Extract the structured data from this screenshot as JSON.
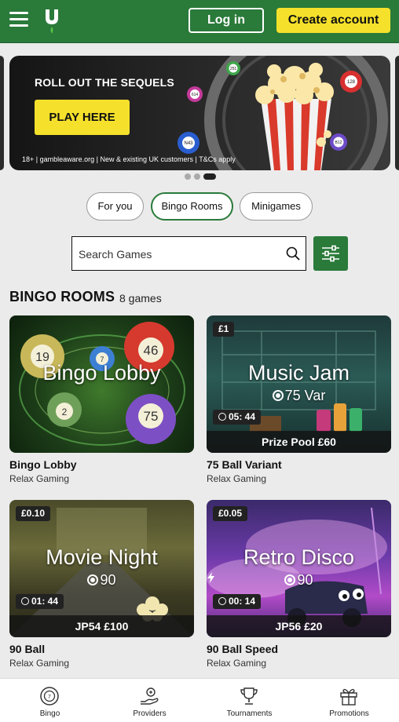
{
  "header": {
    "login_label": "Log in",
    "create_account_label": "Create account",
    "brand_color": "#2a7a3a",
    "accent_color": "#f5e12b"
  },
  "banner": {
    "title": "ROLL OUT THE SEQUELS",
    "cta_label": "PLAY HERE",
    "disclaimer": "18+ | gambleaware.org | New & existing UK customers | T&Cs apply",
    "balls": [
      "251",
      "614",
      "128",
      "N43",
      "B12"
    ],
    "active_slide": 3,
    "slide_count": 3
  },
  "tabs": [
    {
      "label": "For you",
      "active": false
    },
    {
      "label": "Bingo Rooms",
      "active": true
    },
    {
      "label": "Minigames",
      "active": false
    }
  ],
  "search": {
    "placeholder": "Search Games"
  },
  "section": {
    "title": "BINGO ROOMS",
    "count": "8 games"
  },
  "cards": [
    {
      "thumb_title": "Bingo Lobby",
      "thumb_sub": "",
      "price": "",
      "timer": "",
      "prize": "",
      "name": "Bingo Lobby",
      "provider": "Relax Gaming",
      "balls": [
        "19",
        "46",
        "7",
        "2",
        "75"
      ]
    },
    {
      "thumb_title": "Music Jam",
      "thumb_sub": "75 Var",
      "price": "£1",
      "timer": "05: 44",
      "prize": "Prize Pool £60",
      "name": "75 Ball Variant",
      "provider": "Relax Gaming"
    },
    {
      "thumb_title": "Movie Night",
      "thumb_sub": "90",
      "price": "£0.10",
      "timer": "01: 44",
      "prize": "JP54 £100",
      "name": "90 Ball",
      "provider": "Relax Gaming"
    },
    {
      "thumb_title": "Retro Disco",
      "thumb_sub": "90",
      "price": "£0.05",
      "timer": "00: 14",
      "prize": "JP56 £20",
      "name": "90 Ball Speed",
      "provider": "Relax Gaming"
    }
  ],
  "bottom_nav": [
    {
      "label": "Bingo",
      "icon": "bingo-ball-icon"
    },
    {
      "label": "Providers",
      "icon": "providers-icon"
    },
    {
      "label": "Tournaments",
      "icon": "trophy-icon"
    },
    {
      "label": "Promotions",
      "icon": "gift-icon"
    }
  ]
}
